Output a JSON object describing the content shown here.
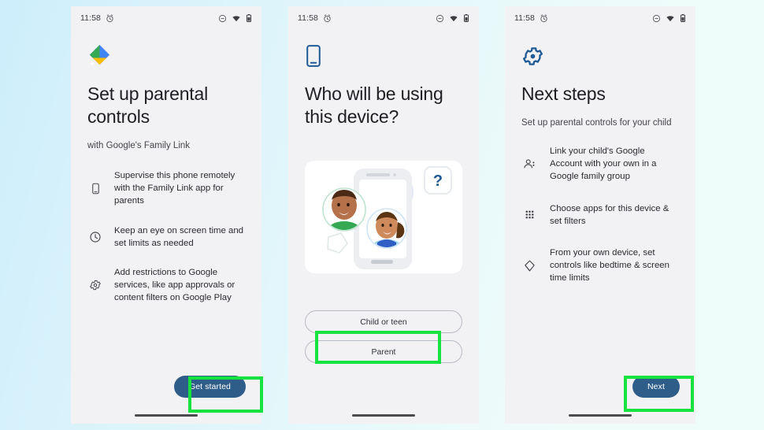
{
  "background": {
    "from_color": "#cdeefb",
    "to_color": "#effdfa"
  },
  "highlight_color": "#16e33f",
  "accent_button_color": "#2f5d8a",
  "status_bar": {
    "time": "11:58",
    "left_icons": [
      "alarm-icon"
    ],
    "right_icons": [
      "do-not-disturb-icon",
      "wifi-icon",
      "battery-icon"
    ]
  },
  "screens": [
    {
      "id": "setup",
      "hero_icon": "family-link-logo",
      "title": "Set up parental controls",
      "subtitle": "with Google's Family Link",
      "features": [
        {
          "icon": "phone-icon",
          "text": "Supervise this phone remotely with the Family Link app for parents"
        },
        {
          "icon": "clock-icon",
          "text": "Keep an eye on screen time and set limits as needed"
        },
        {
          "icon": "settings-gear-icon",
          "text": "Add restrictions to Google services, like app approvals or content filters on Google Play"
        }
      ],
      "cta_label": "Get started"
    },
    {
      "id": "who-is-using",
      "hero_icon": "device-phone-icon",
      "title": "Who will be using this device?",
      "illustration": "parent-and-child-with-phone-illustration",
      "choices": [
        {
          "label": "Child or teen",
          "highlighted": true
        },
        {
          "label": "Parent",
          "highlighted": false
        }
      ]
    },
    {
      "id": "next-steps",
      "hero_icon": "settings-gear-icon",
      "title": "Next steps",
      "subtitle": "Set up parental controls for your child",
      "features": [
        {
          "icon": "person-add-icon",
          "text": "Link your child's Google Account with your own in a Google family group"
        },
        {
          "icon": "apps-grid-icon",
          "text": "Choose apps for this device & set filters"
        },
        {
          "icon": "kite-shape-icon",
          "text": "From your own device, set controls like bedtime & screen time limits"
        }
      ],
      "cta_label": "Next"
    }
  ]
}
